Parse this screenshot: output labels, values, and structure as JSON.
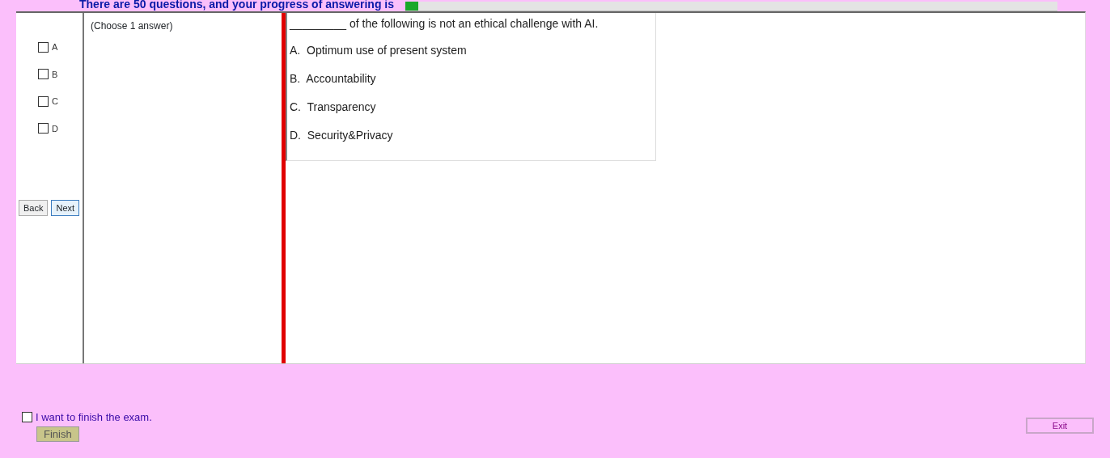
{
  "header": {
    "text": "There are 50 questions, and your progress of answering is",
    "progress": {
      "level": 0.02
    }
  },
  "answer_panel": {
    "instruction": "(Choose 1 answer)",
    "options": [
      {
        "label": "A",
        "checked": false
      },
      {
        "label": "B",
        "checked": false
      },
      {
        "label": "C",
        "checked": false
      },
      {
        "label": "D",
        "checked": false
      }
    ],
    "buttons": [
      {
        "label": "Back",
        "selected": false
      },
      {
        "label": "Next",
        "selected": true
      }
    ]
  },
  "question": {
    "blank": "_________",
    "text": "of the following is not an ethical challenge with AI.",
    "choices": [
      "A.  Optimum use of present system",
      "B.  Accountability",
      "C.  Transparency",
      "D.  Security&Privacy"
    ]
  },
  "finish": {
    "label": "I want to finish the exam.",
    "checked": false,
    "button": "Finish"
  },
  "exit_button": "Exit"
}
